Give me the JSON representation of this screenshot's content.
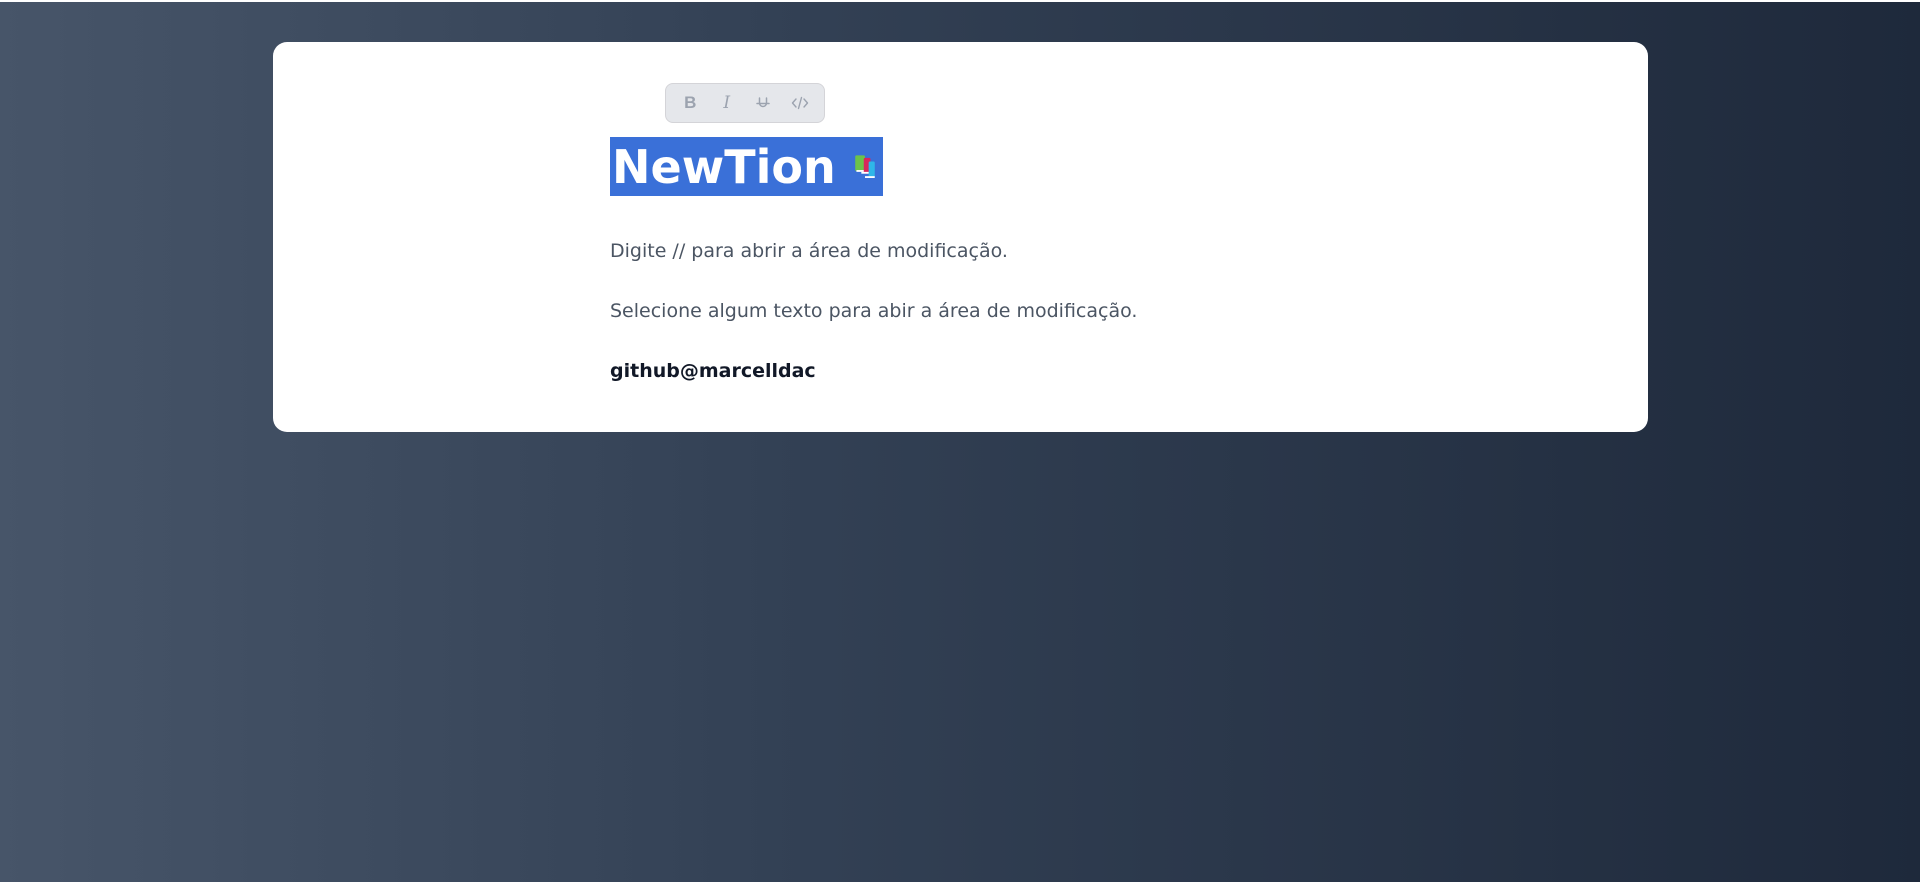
{
  "toolbar": {
    "bold_label": "B",
    "italic_label": "I",
    "strike_icon": "strikethrough-icon",
    "code_icon": "code-icon"
  },
  "document": {
    "title": "NewTion",
    "title_icon": "books-icon",
    "paragraphs": [
      "Digite // para abrir a área de modificação.",
      "Selecione algum texto para abir a área de modificação.",
      "github@marcelldac"
    ]
  },
  "colors": {
    "selection": "#3a70d8",
    "card": "#ffffff",
    "background_start": "#475569",
    "background_end": "#1e293b"
  }
}
